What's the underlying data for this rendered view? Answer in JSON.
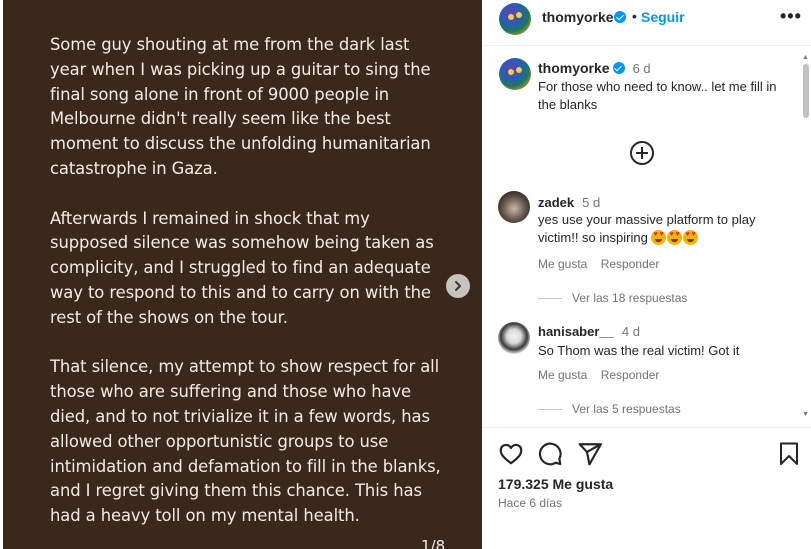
{
  "post": {
    "paragraphs": [
      "Some guy shouting at me from the dark last year when I was picking up a guitar to sing the final song alone in front of 9000 people in Melbourne didn't really seem like the best moment to discuss the unfolding humanitarian catastrophe in Gaza.",
      "Afterwards I remained in shock that my supposed silence was somehow being taken as complicity, and I struggled to find an adequate way to respond to this and to carry on with the rest of the shows on the tour.",
      "That silence, my attempt to show respect for all those who are suffering and those who have died, and to not trivialize it in a few words, has allowed other opportunistic groups to use intimidation and defamation to fill in the blanks, and I regret giving them this chance. This has had a heavy toll on my mental health."
    ],
    "page_counter": "1/8",
    "next_icon": "chevron-right-icon"
  },
  "header": {
    "username": "thomyorke",
    "separator": "•",
    "follow_label": "Seguir",
    "more_label": "•••"
  },
  "caption": {
    "username": "thomyorke",
    "time": "6 d",
    "text": "For those who need to know.. let me fill in the blanks"
  },
  "comments": [
    {
      "username": "zadek",
      "time": "5 d",
      "text": "yes use your massive platform to play victim!! so inspiring",
      "emojis": [
        "heart-eyes-emoji",
        "heart-eyes-emoji",
        "heart-eyes-emoji"
      ],
      "like_label": "Me gusta",
      "reply_label": "Responder",
      "replies_label": "Ver las 18 respuestas"
    },
    {
      "username": "hanisaber__",
      "time": "4 d",
      "text": "So Thom was the real victim! Got it",
      "like_label": "Me gusta",
      "reply_label": "Responder",
      "replies_label": "Ver las 5 respuestas"
    }
  ],
  "footer": {
    "likes": "179.325 Me gusta",
    "date": "Hace 6 días"
  },
  "colors": {
    "post_background": "#3a281c",
    "accent": "#0095f6",
    "verified": "#0095f6"
  }
}
